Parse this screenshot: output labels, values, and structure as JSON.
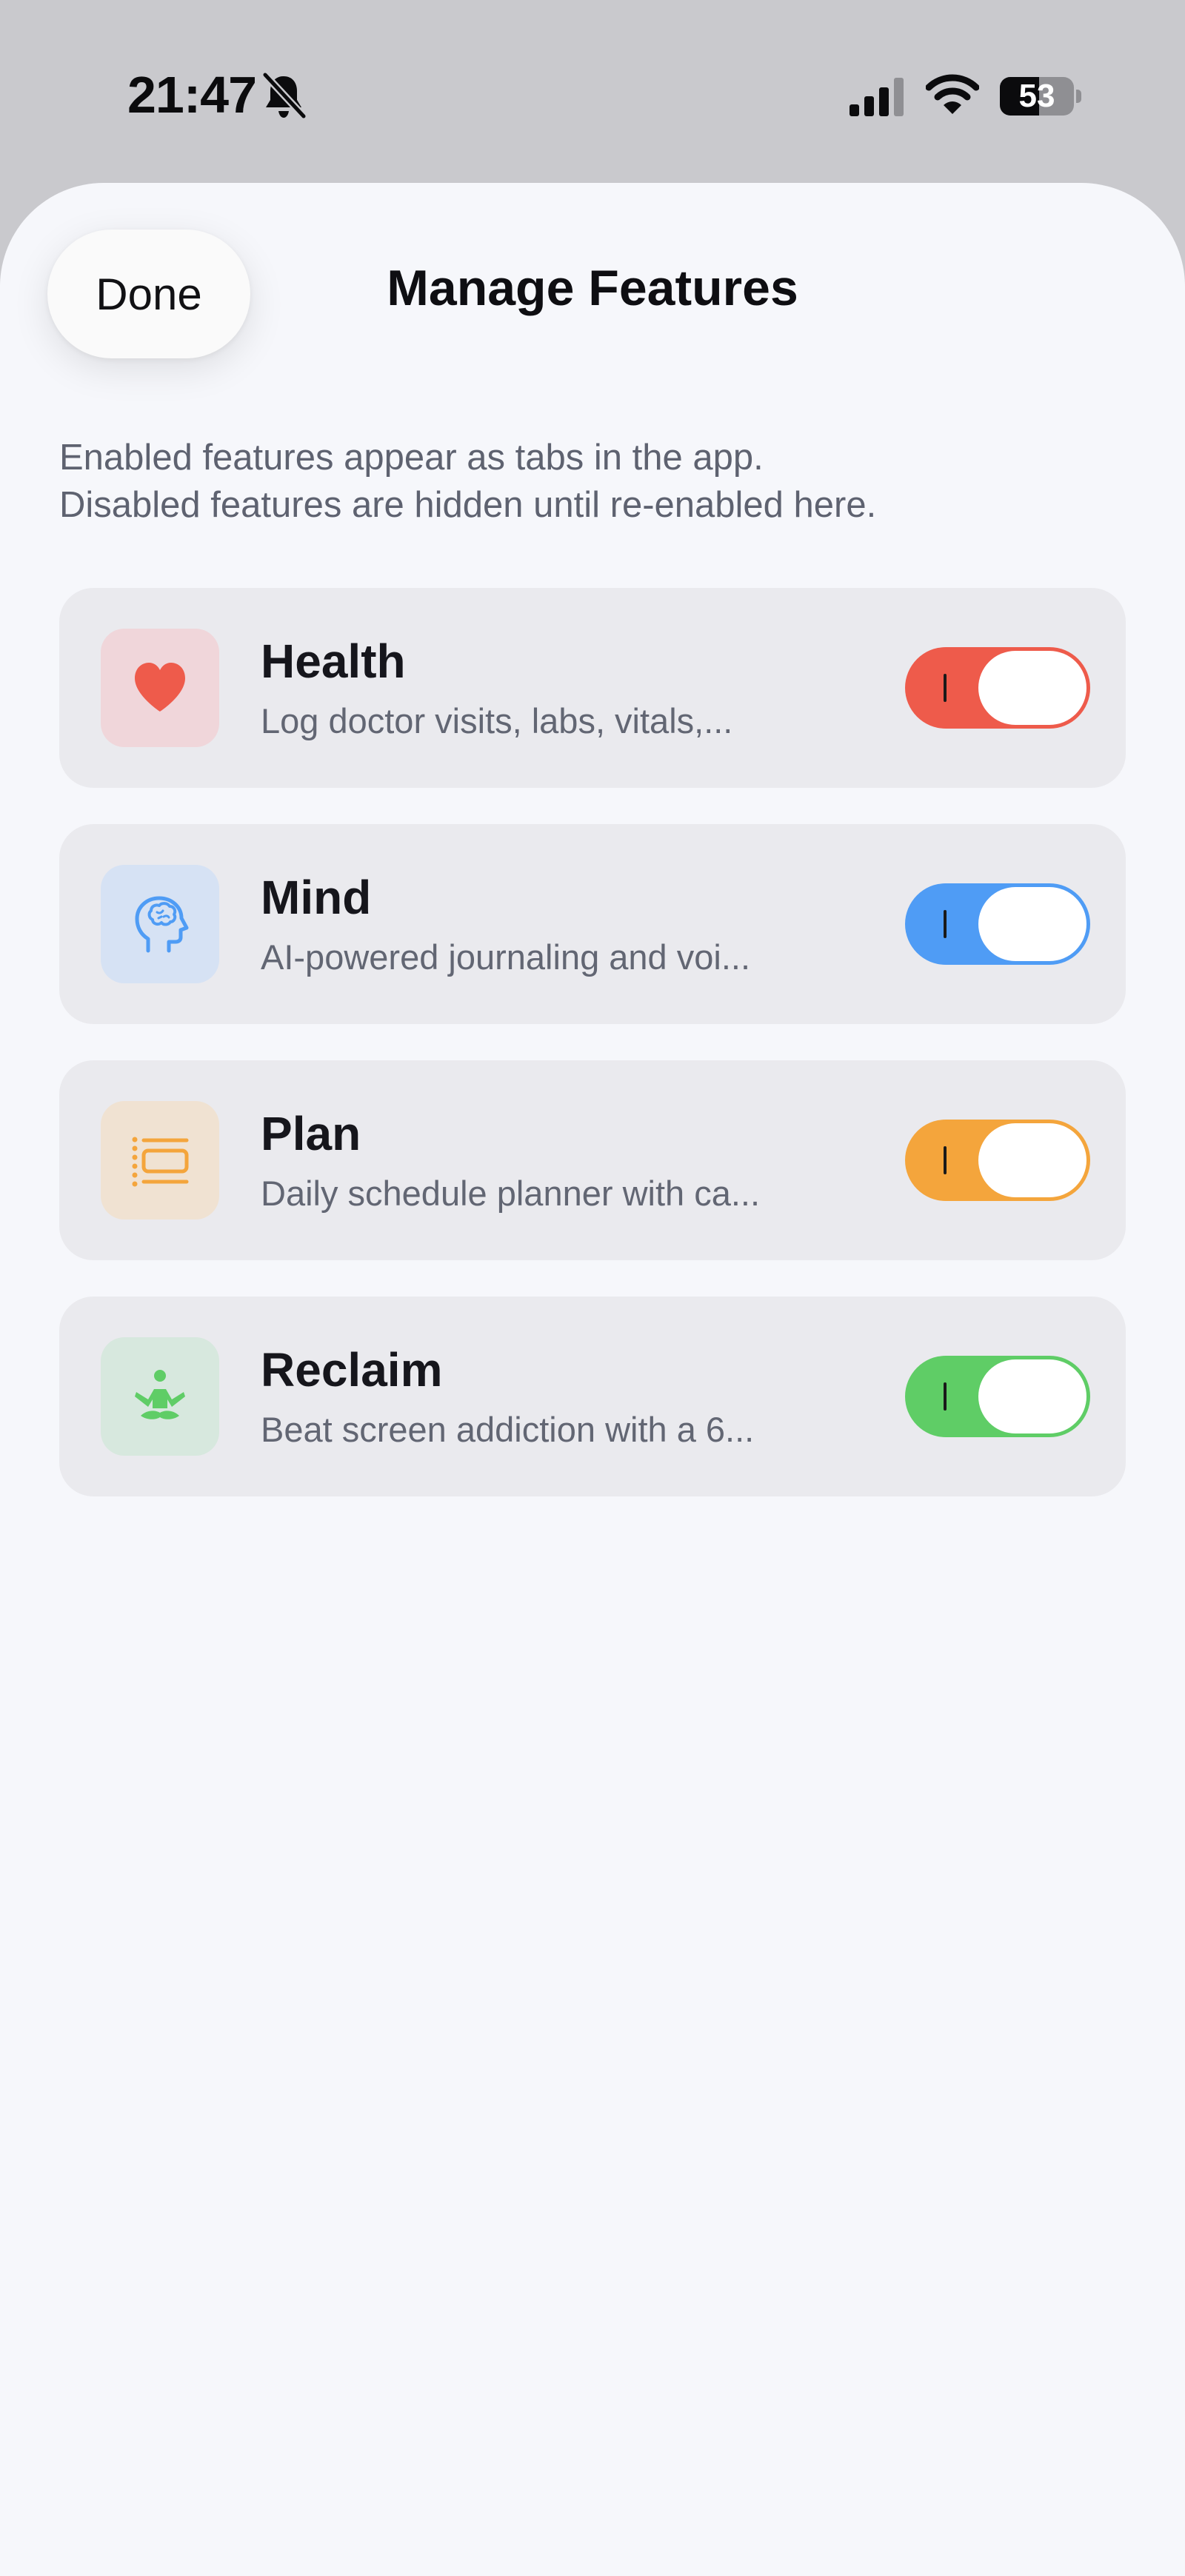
{
  "status_bar": {
    "time": "21:47",
    "battery_text": "53",
    "battery_level": 0.53
  },
  "header": {
    "done_label": "Done",
    "title": "Manage Features"
  },
  "description": {
    "line1": "Enabled features appear as tabs in the app.",
    "line2": "Disabled features are hidden until re-enabled here."
  },
  "features": [
    {
      "name": "Health",
      "description": "Log doctor visits, labs, vitals,...",
      "icon": "heart-icon",
      "accent": "#ee5b4b",
      "tile_bg": "#f0d6da",
      "enabled": true
    },
    {
      "name": "Mind",
      "description": "AI-powered journaling and voi...",
      "icon": "brain-head-icon",
      "accent": "#4f9cf5",
      "tile_bg": "#d6e2f4",
      "enabled": true
    },
    {
      "name": "Plan",
      "description": "Daily schedule planner with ca...",
      "icon": "schedule-list-icon",
      "accent": "#f4a53c",
      "tile_bg": "#f0e2d2",
      "enabled": true
    },
    {
      "name": "Reclaim",
      "description": "Beat screen addiction with a 6...",
      "icon": "meditation-icon",
      "accent": "#5fcd66",
      "tile_bg": "#d7e8de",
      "enabled": true
    }
  ]
}
